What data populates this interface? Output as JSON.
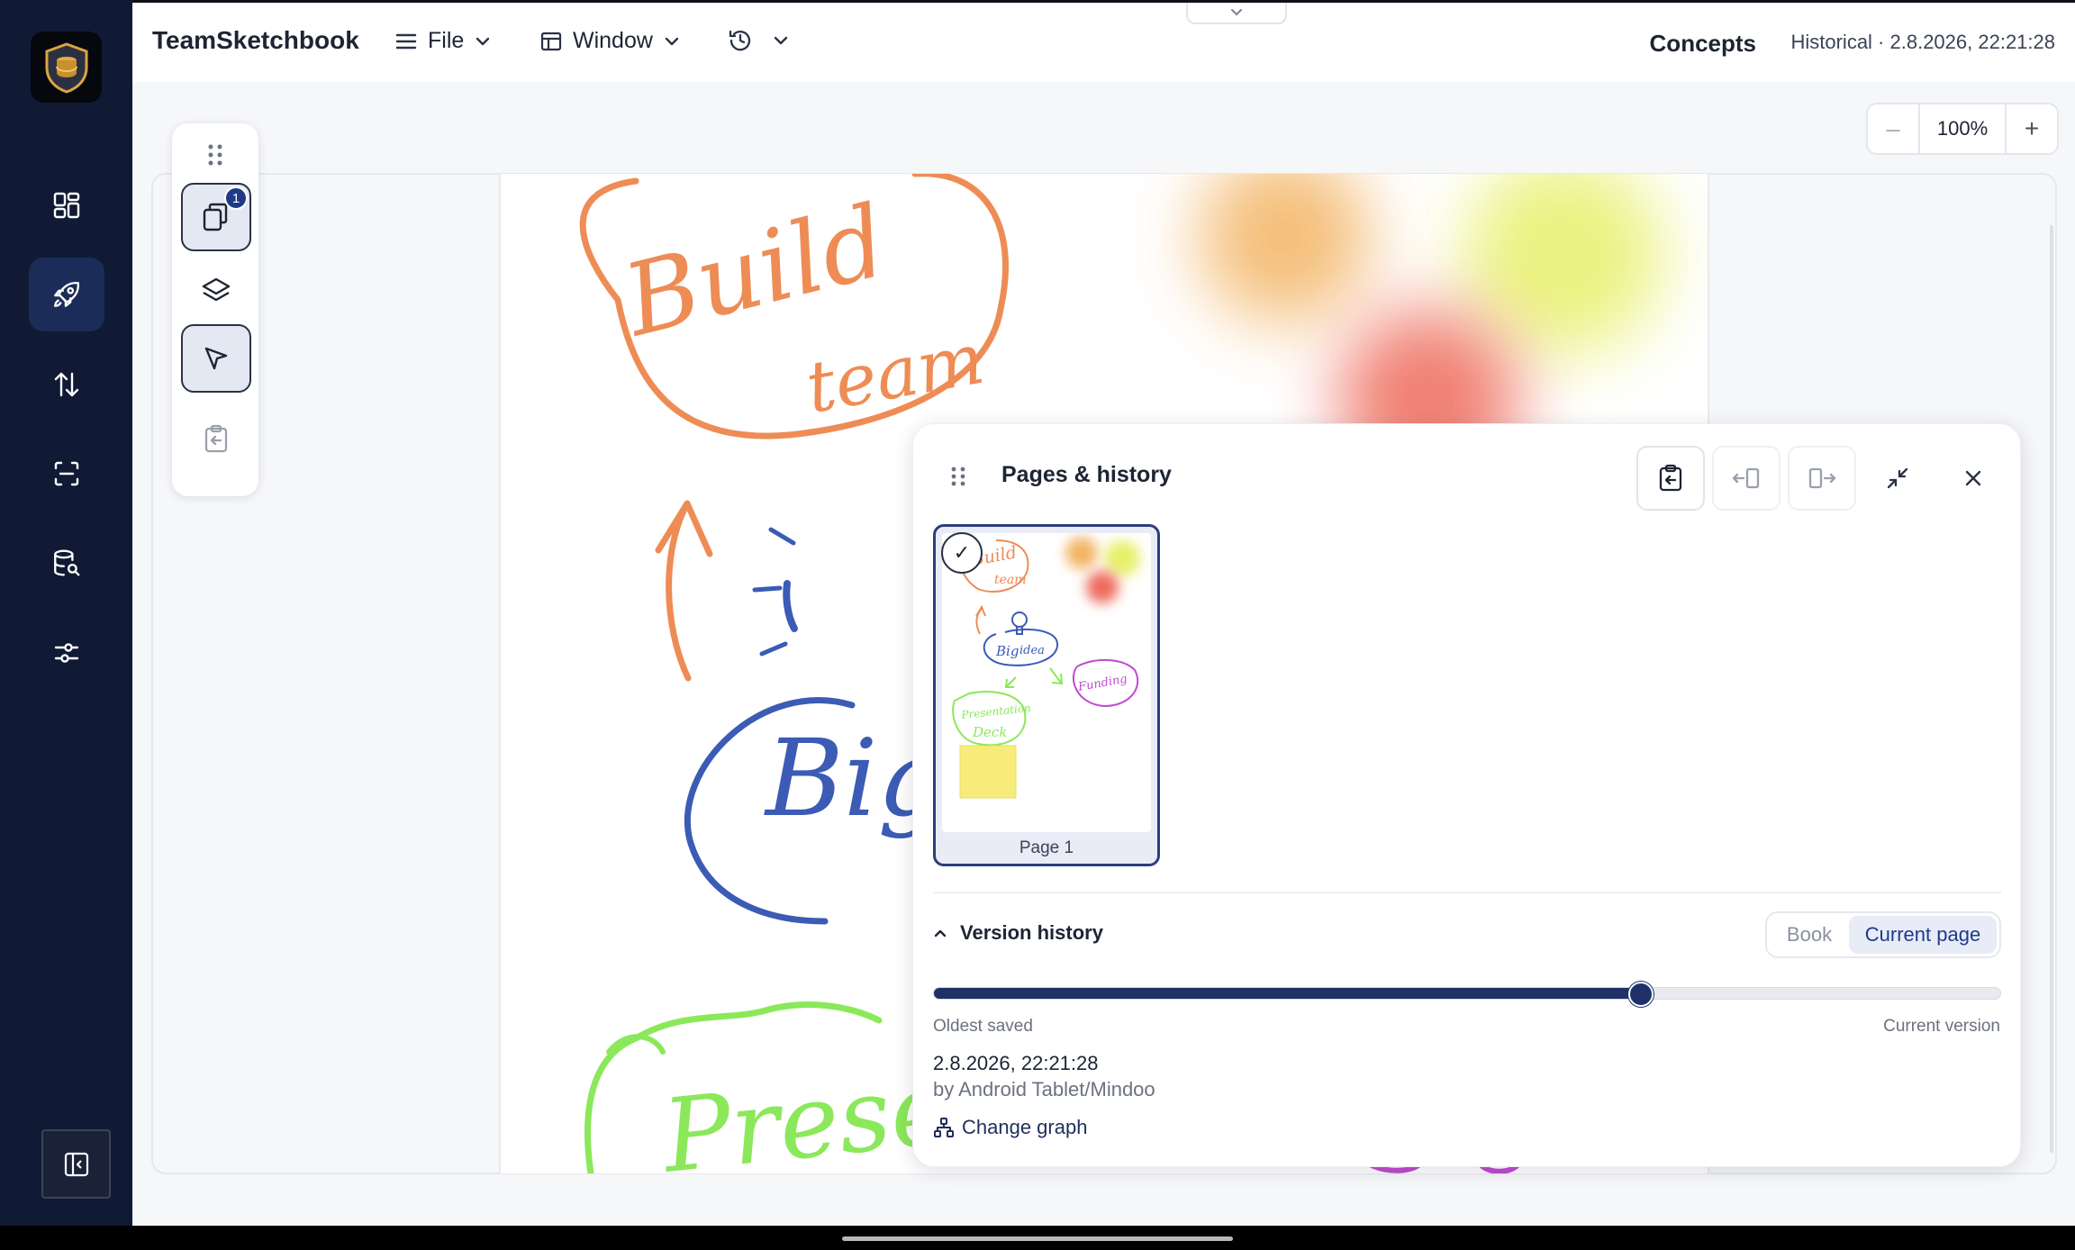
{
  "app": {
    "title": "TeamSketchbook"
  },
  "menu": {
    "file": "File",
    "window": "Window"
  },
  "header": {
    "context": "Concepts",
    "status": "Historical · 2.8.2026, 22:21:28"
  },
  "zoom": {
    "value": "100%",
    "minus": "–",
    "plus": "+"
  },
  "rail": {
    "items": [
      {
        "icon": "dashboard-grid-icon"
      },
      {
        "icon": "rocket-icon",
        "active": true
      },
      {
        "icon": "sort-arrows-icon"
      },
      {
        "icon": "scan-icon"
      },
      {
        "icon": "database-search-icon"
      },
      {
        "icon": "sliders-icon"
      }
    ],
    "bottom_icon": "sidebar-toggle-icon"
  },
  "tools": {
    "pages_badge": "1"
  },
  "panel": {
    "title": "Pages & history",
    "pages": [
      {
        "label": "Page 1",
        "selected": true
      }
    ],
    "version_history": {
      "title": "Version history",
      "segments": {
        "book": "Book",
        "current_page": "Current page",
        "selected": "current_page"
      },
      "slider_position": 0.663,
      "oldest_label": "Oldest saved",
      "current_label": "Current version",
      "date": "2.8.2026, 22:21:28",
      "by": "by Android Tablet/Mindoo",
      "change_graph": "Change graph"
    }
  },
  "colors": {
    "rail": "#101a35",
    "accent": "#1f3168",
    "orange_ink": "#ee8c55",
    "blue_ink": "#3b5bb5",
    "green_ink": "#8be85a"
  },
  "sketch": {
    "text": {
      "build": "Build",
      "team": "team",
      "big": "Big",
      "idea": "idea",
      "funding": "Funding",
      "presentation": "Presentation",
      "deck": "Deck",
      "present_partial": "Present"
    }
  }
}
